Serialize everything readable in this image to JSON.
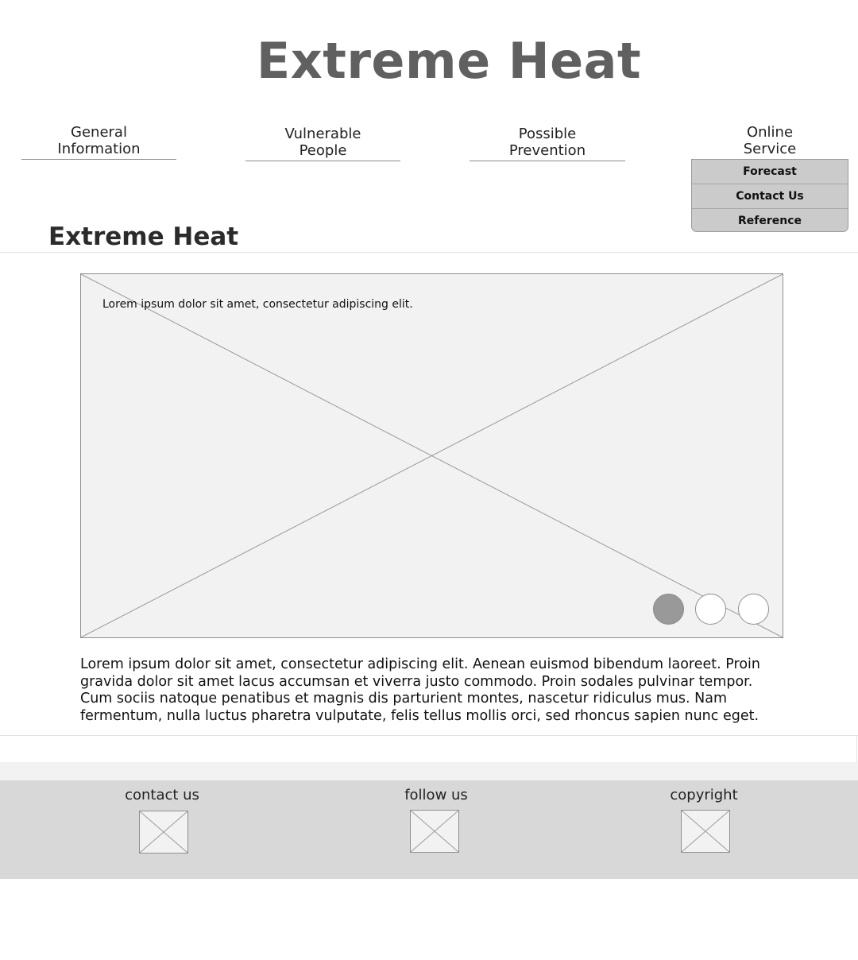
{
  "site": {
    "title": "Extreme Heat"
  },
  "nav": {
    "items": [
      {
        "line1": "General",
        "line2": "Information"
      },
      {
        "line1": "Vulnerable",
        "line2": "People"
      },
      {
        "line1": "Possible",
        "line2": "Prevention"
      },
      {
        "line1": "Online",
        "line2": "Service"
      }
    ],
    "dropdown": [
      "Forecast",
      "Contact Us",
      "Reference"
    ]
  },
  "section": {
    "title": "Extreme Heat"
  },
  "carousel": {
    "caption": "Lorem ipsum dolor sit amet, consectetur adipiscing elit.",
    "slide_count": 3,
    "active_index": 0
  },
  "body": {
    "paragraph": "Lorem ipsum dolor sit amet, consectetur adipiscing elit. Aenean euismod bibendum laoreet. Proin gravida dolor sit amet lacus accumsan et viverra justo commodo. Proin sodales pulvinar tempor. Cum sociis natoque penatibus et magnis dis parturient montes, nascetur ridiculus mus. Nam fermentum, nulla luctus pharetra vulputate, felis tellus mollis orci, sed rhoncus sapien nunc eget."
  },
  "footer": {
    "columns": [
      {
        "label": "contact us"
      },
      {
        "label": "follow us"
      },
      {
        "label": "copyright"
      }
    ]
  },
  "colors": {
    "title": "#606060",
    "placeholder_fill": "#f2f2f2",
    "footer_bg": "#d8d8d8",
    "dropdown_bg": "#cbcbcb",
    "active_dot": "#999999"
  }
}
